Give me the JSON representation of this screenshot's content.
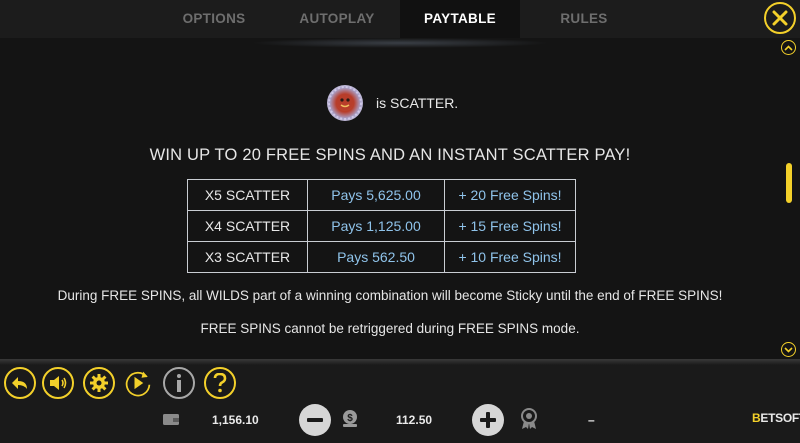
{
  "tabs": [
    {
      "label": "OPTIONS",
      "active": false
    },
    {
      "label": "AUTOPLAY",
      "active": false
    },
    {
      "label": "PAYTABLE",
      "active": true
    },
    {
      "label": "RULES",
      "active": false
    }
  ],
  "paytable": {
    "scatter_caption": "is SCATTER.",
    "headline": "WIN UP TO 20 FREE SPINS AND AN INSTANT SCATTER PAY!",
    "rows": [
      {
        "symbol": "X5 SCATTER",
        "pays": "Pays 5,625.00",
        "spins": "+ 20 Free Spins!"
      },
      {
        "symbol": "X4 SCATTER",
        "pays": "Pays 1,125.00",
        "spins": "+ 15 Free Spins!"
      },
      {
        "symbol": "X3 SCATTER",
        "pays": "Pays 562.50",
        "spins": "+ 10 Free Spins!"
      }
    ],
    "note_sticky": "During FREE SPINS, all WILDS part of a winning combination will become Sticky until the end of FREE SPINS!",
    "note_retrigger": "FREE SPINS cannot be retriggered during FREE SPINS mode."
  },
  "status": {
    "balance": "1,156.10",
    "bet": "112.50",
    "win": "–"
  },
  "brand": {
    "logo_b": "B",
    "logo_rest": "ETSOFT"
  },
  "colors": {
    "accent": "#f3d02a",
    "value_blue": "#8fc3ea",
    "background": "#141414"
  },
  "icons": [
    "close-icon",
    "back-arrow-icon",
    "sound-icon",
    "gear-icon",
    "autoplay-icon",
    "info-icon",
    "help-icon",
    "wallet-icon",
    "minus-icon",
    "coins-icon",
    "plus-icon",
    "bonus-badge-icon",
    "chevron-up-icon",
    "chevron-down-icon"
  ]
}
